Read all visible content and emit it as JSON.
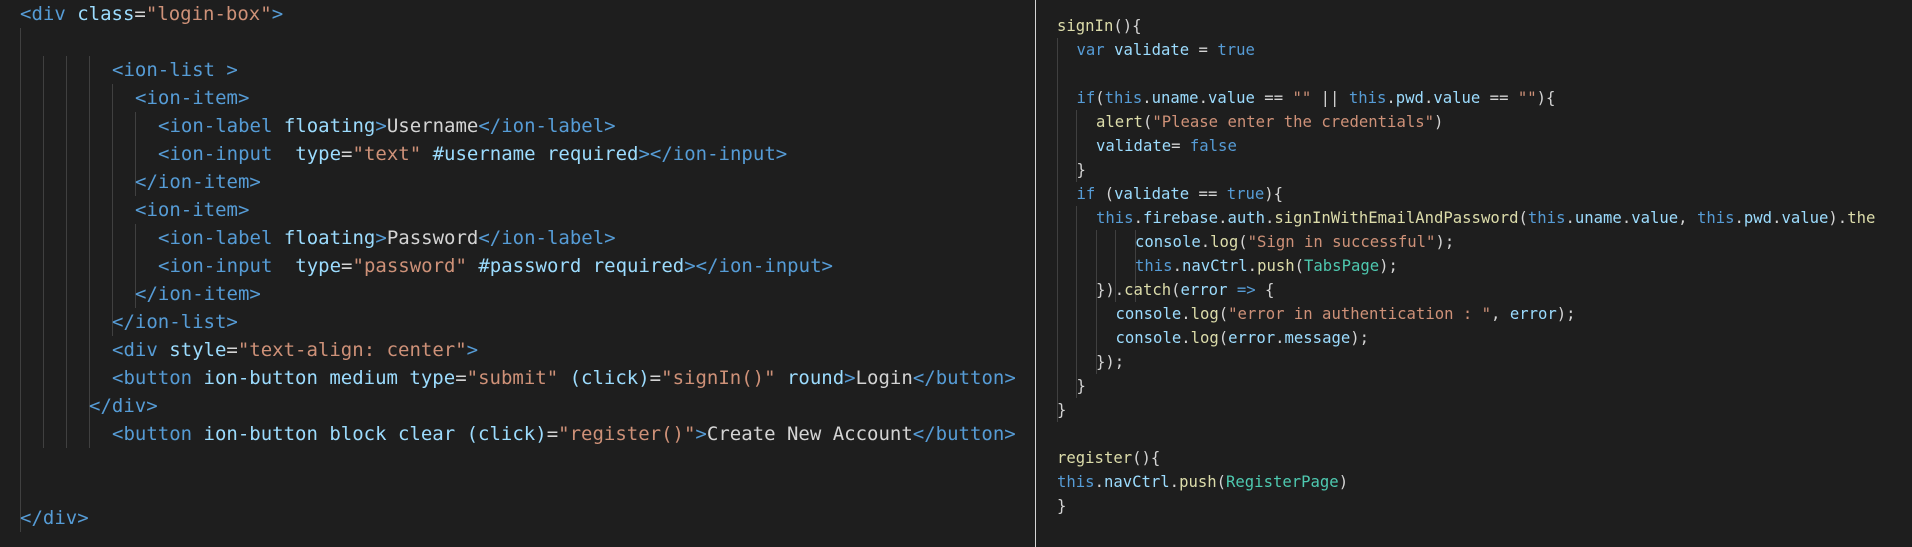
{
  "colors": {
    "background": "#1e1e1e",
    "tag": "#569cd6",
    "attribute": "#9cdcfe",
    "string": "#ce9178",
    "text": "#d4d4d4",
    "function": "#dcdcaa",
    "keyword": "#569cd6",
    "class": "#4ec9b0",
    "divider": "#d4d4d4"
  },
  "left_editor": {
    "lines": [
      [
        [
          "tag",
          "<div "
        ],
        [
          "attr",
          "class"
        ],
        [
          "text",
          "="
        ],
        [
          "str",
          "\"login-box\""
        ],
        [
          "tag",
          ">"
        ]
      ],
      [],
      [
        [
          "tag",
          "<ion-list "
        ],
        [
          "tag",
          ">"
        ]
      ],
      [
        [
          "tag",
          "<ion-item>"
        ]
      ],
      [
        [
          "tag",
          "<ion-label "
        ],
        [
          "attr",
          "floating"
        ],
        [
          "tag",
          ">"
        ],
        [
          "text",
          "Username"
        ],
        [
          "tag",
          "</ion-label>"
        ]
      ],
      [
        [
          "tag",
          "<ion-input  "
        ],
        [
          "attr",
          "type"
        ],
        [
          "text",
          "="
        ],
        [
          "str",
          "\"text\""
        ],
        [
          "attr",
          " #username required"
        ],
        [
          "tag",
          "></ion-input>"
        ]
      ],
      [
        [
          "tag",
          "</ion-item>"
        ]
      ],
      [
        [
          "tag",
          "<ion-item>"
        ]
      ],
      [
        [
          "tag",
          "<ion-label "
        ],
        [
          "attr",
          "floating"
        ],
        [
          "tag",
          ">"
        ],
        [
          "text",
          "Password"
        ],
        [
          "tag",
          "</ion-label>"
        ]
      ],
      [
        [
          "tag",
          "<ion-input  "
        ],
        [
          "attr",
          "type"
        ],
        [
          "text",
          "="
        ],
        [
          "str",
          "\"password\""
        ],
        [
          "attr",
          " #password required"
        ],
        [
          "tag",
          "></ion-input>"
        ]
      ],
      [
        [
          "tag",
          "</ion-item>"
        ]
      ],
      [
        [
          "tag",
          "</ion-list>"
        ]
      ],
      [
        [
          "tag",
          "<div "
        ],
        [
          "attr",
          "style"
        ],
        [
          "text",
          "="
        ],
        [
          "str",
          "\"text-align: center\""
        ],
        [
          "tag",
          ">"
        ]
      ],
      [
        [
          "tag",
          "<button "
        ],
        [
          "attr",
          "ion-button medium type"
        ],
        [
          "text",
          "="
        ],
        [
          "str",
          "\"submit\""
        ],
        [
          "attr",
          " (click)"
        ],
        [
          "text",
          "="
        ],
        [
          "str",
          "\"signIn()\""
        ],
        [
          "attr",
          " round"
        ],
        [
          "tag",
          ">"
        ],
        [
          "text",
          "Login"
        ],
        [
          "tag",
          "</button>"
        ]
      ],
      [
        [
          "tag",
          "</div>"
        ]
      ],
      [
        [
          "tag",
          "<button "
        ],
        [
          "attr",
          "ion-button block clear (click)"
        ],
        [
          "text",
          "="
        ],
        [
          "str",
          "\"register()\""
        ],
        [
          "tag",
          ">"
        ],
        [
          "text",
          "Create New Account"
        ],
        [
          "tag",
          "</button>"
        ]
      ],
      [],
      [],
      [
        [
          "tag",
          "</div>"
        ]
      ]
    ]
  },
  "right_editor": {
    "lines": [
      [
        [
          "fn",
          "signIn"
        ],
        [
          "punc",
          "(){"
        ]
      ],
      [
        [
          "kw",
          "var "
        ],
        [
          "var",
          "validate"
        ],
        [
          "punc",
          " = "
        ],
        [
          "kw",
          "true"
        ]
      ],
      [],
      [
        [
          "kw",
          "if"
        ],
        [
          "punc",
          "("
        ],
        [
          "kw",
          "this"
        ],
        [
          "punc",
          "."
        ],
        [
          "var",
          "uname"
        ],
        [
          "punc",
          "."
        ],
        [
          "var",
          "value"
        ],
        [
          "punc",
          " == "
        ],
        [
          "str",
          "\"\""
        ],
        [
          "punc",
          " || "
        ],
        [
          "kw",
          "this"
        ],
        [
          "punc",
          "."
        ],
        [
          "var",
          "pwd"
        ],
        [
          "punc",
          "."
        ],
        [
          "var",
          "value"
        ],
        [
          "punc",
          " == "
        ],
        [
          "str",
          "\"\""
        ],
        [
          "punc",
          "){"
        ]
      ],
      [
        [
          "fn",
          "alert"
        ],
        [
          "punc",
          "("
        ],
        [
          "str",
          "\"Please enter the credentials\""
        ],
        [
          "punc",
          ")"
        ]
      ],
      [
        [
          "var",
          "validate"
        ],
        [
          "punc",
          "= "
        ],
        [
          "kw",
          "false"
        ]
      ],
      [
        [
          "punc",
          "}"
        ]
      ],
      [
        [
          "kw",
          "if "
        ],
        [
          "punc",
          "("
        ],
        [
          "var",
          "validate"
        ],
        [
          "punc",
          " == "
        ],
        [
          "kw",
          "true"
        ],
        [
          "punc",
          "){"
        ]
      ],
      [
        [
          "kw",
          "this"
        ],
        [
          "punc",
          "."
        ],
        [
          "var",
          "firebase"
        ],
        [
          "punc",
          "."
        ],
        [
          "var",
          "auth"
        ],
        [
          "punc",
          "."
        ],
        [
          "fn",
          "signInWithEmailAndPassword"
        ],
        [
          "punc",
          "("
        ],
        [
          "kw",
          "this"
        ],
        [
          "punc",
          "."
        ],
        [
          "var",
          "uname"
        ],
        [
          "punc",
          "."
        ],
        [
          "var",
          "value"
        ],
        [
          "punc",
          ", "
        ],
        [
          "kw",
          "this"
        ],
        [
          "punc",
          "."
        ],
        [
          "var",
          "pwd"
        ],
        [
          "punc",
          "."
        ],
        [
          "var",
          "value"
        ],
        [
          "punc",
          ")."
        ],
        [
          "fn",
          "the"
        ]
      ],
      [
        [
          "var",
          "console"
        ],
        [
          "punc",
          "."
        ],
        [
          "fn",
          "log"
        ],
        [
          "punc",
          "("
        ],
        [
          "str",
          "\"Sign in successful\""
        ],
        [
          "punc",
          ");"
        ]
      ],
      [
        [
          "kw",
          "this"
        ],
        [
          "punc",
          "."
        ],
        [
          "var",
          "navCtrl"
        ],
        [
          "punc",
          "."
        ],
        [
          "fn",
          "push"
        ],
        [
          "punc",
          "("
        ],
        [
          "cls",
          "TabsPage"
        ],
        [
          "punc",
          ");"
        ]
      ],
      [
        [
          "punc",
          "})."
        ],
        [
          "fn",
          "catch"
        ],
        [
          "punc",
          "("
        ],
        [
          "var",
          "error"
        ],
        [
          "kw",
          " => "
        ],
        [
          "punc",
          "{"
        ]
      ],
      [
        [
          "var",
          "console"
        ],
        [
          "punc",
          "."
        ],
        [
          "fn",
          "log"
        ],
        [
          "punc",
          "("
        ],
        [
          "str",
          "\"error in authentication : \""
        ],
        [
          "punc",
          ", "
        ],
        [
          "var",
          "error"
        ],
        [
          "punc",
          ");"
        ]
      ],
      [
        [
          "var",
          "console"
        ],
        [
          "punc",
          "."
        ],
        [
          "fn",
          "log"
        ],
        [
          "punc",
          "("
        ],
        [
          "var",
          "error"
        ],
        [
          "punc",
          "."
        ],
        [
          "var",
          "message"
        ],
        [
          "punc",
          ");"
        ]
      ],
      [
        [
          "punc",
          "});"
        ]
      ],
      [
        [
          "punc",
          "}"
        ]
      ],
      [
        [
          "punc",
          "}"
        ]
      ],
      [],
      [
        [
          "fn",
          "register"
        ],
        [
          "punc",
          "(){"
        ]
      ],
      [
        [
          "kw",
          "this"
        ],
        [
          "punc",
          "."
        ],
        [
          "var",
          "navCtrl"
        ],
        [
          "punc",
          "."
        ],
        [
          "fn",
          "push"
        ],
        [
          "punc",
          "("
        ],
        [
          "cls",
          "RegisterPage"
        ],
        [
          "punc",
          ")"
        ]
      ],
      [
        [
          "punc",
          "}"
        ]
      ]
    ]
  }
}
